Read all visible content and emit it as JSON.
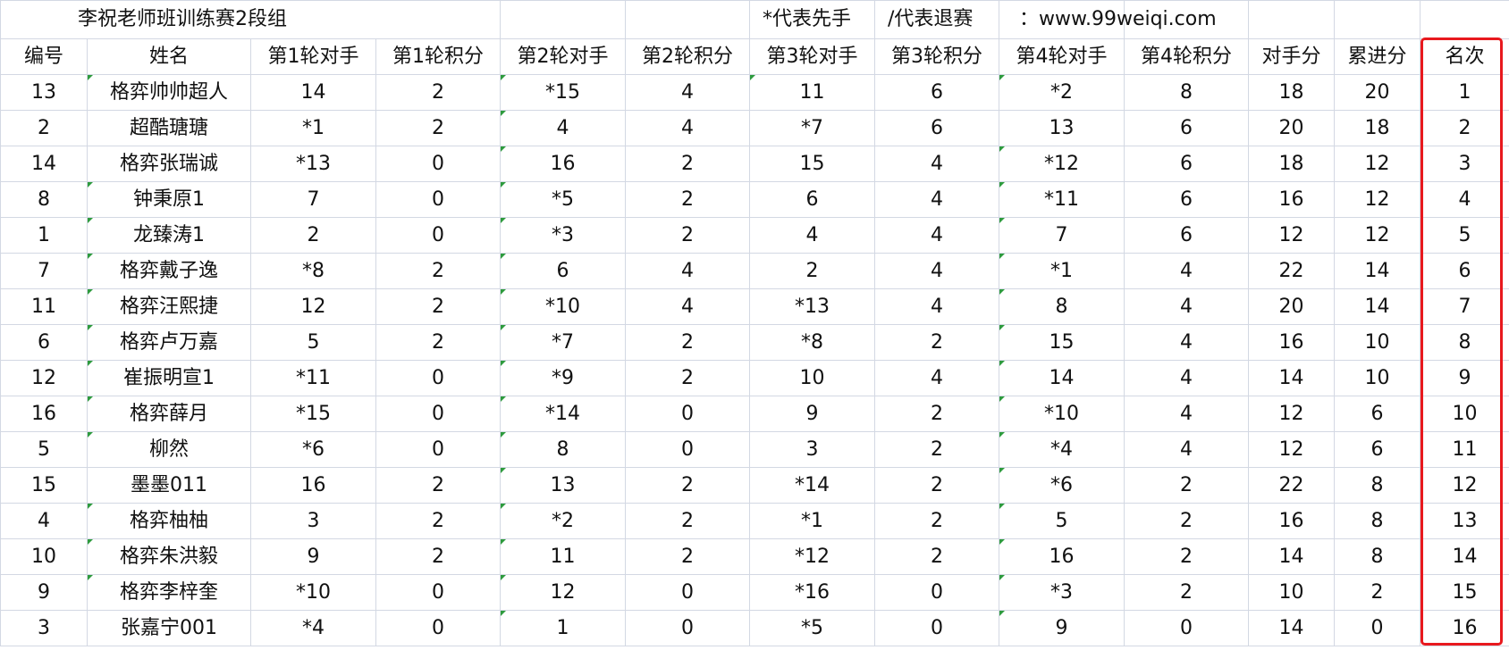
{
  "sheet": {
    "title": "李祝老师班训练赛2段组",
    "note_first_move": "*代表先手",
    "note_withdraw": "/代表退赛",
    "website": "：www.99weiqi.com",
    "headers": [
      "编号",
      "姓名",
      "第1轮对手",
      "第1轮积分",
      "第2轮对手",
      "第2轮积分",
      "第3轮对手",
      "第3轮积分",
      "第4轮对手",
      "第4轮积分",
      "对手分",
      "累进分",
      "名次"
    ],
    "rows": [
      [
        "13",
        "格弈帅帅超人",
        "14",
        "2",
        "*15",
        "4",
        "11",
        "6",
        "*2",
        "8",
        "18",
        "20",
        "1"
      ],
      [
        "2",
        "超酷瑭瑭",
        "*1",
        "2",
        "4",
        "4",
        "*7",
        "6",
        "13",
        "6",
        "20",
        "18",
        "2"
      ],
      [
        "14",
        "格弈张瑞诚",
        "*13",
        "0",
        "16",
        "2",
        "15",
        "4",
        "*12",
        "6",
        "18",
        "12",
        "3"
      ],
      [
        "8",
        "钟秉原1",
        "7",
        "0",
        "*5",
        "2",
        "6",
        "4",
        "*11",
        "6",
        "16",
        "12",
        "4"
      ],
      [
        "1",
        "龙臻涛1",
        "2",
        "0",
        "*3",
        "2",
        "4",
        "4",
        "7",
        "6",
        "12",
        "12",
        "5"
      ],
      [
        "7",
        "格弈戴子逸",
        "*8",
        "2",
        "6",
        "4",
        "2",
        "4",
        "*1",
        "4",
        "22",
        "14",
        "6"
      ],
      [
        "11",
        "格弈汪熙捷",
        "12",
        "2",
        "*10",
        "4",
        "*13",
        "4",
        "8",
        "4",
        "20",
        "14",
        "7"
      ],
      [
        "6",
        "格弈卢万嘉",
        "5",
        "2",
        "*7",
        "2",
        "*8",
        "2",
        "15",
        "4",
        "16",
        "10",
        "8"
      ],
      [
        "12",
        "崔振明宣1",
        "*11",
        "0",
        "*9",
        "2",
        "10",
        "4",
        "14",
        "4",
        "14",
        "10",
        "9"
      ],
      [
        "16",
        "格弈薛月",
        "*15",
        "0",
        "*14",
        "0",
        "9",
        "2",
        "*10",
        "4",
        "12",
        "6",
        "10"
      ],
      [
        "5",
        "柳然",
        "*6",
        "0",
        "8",
        "0",
        "3",
        "2",
        "*4",
        "4",
        "12",
        "6",
        "11"
      ],
      [
        "15",
        "墨墨011",
        "16",
        "2",
        "13",
        "2",
        "*14",
        "2",
        "*6",
        "2",
        "22",
        "8",
        "12"
      ],
      [
        "4",
        "格弈柚柚",
        "3",
        "2",
        "*2",
        "2",
        "*1",
        "2",
        "5",
        "2",
        "16",
        "8",
        "13"
      ],
      [
        "10",
        "格弈朱洪毅",
        "9",
        "2",
        "11",
        "2",
        "*12",
        "2",
        "16",
        "2",
        "14",
        "8",
        "14"
      ],
      [
        "9",
        "格弈李梓奎",
        "*10",
        "0",
        "12",
        "0",
        "*16",
        "0",
        "*3",
        "2",
        "10",
        "2",
        "15"
      ],
      [
        "3",
        "张嘉宁001",
        "*4",
        "0",
        "1",
        "0",
        "*5",
        "0",
        "9",
        "0",
        "14",
        "0",
        "16"
      ]
    ],
    "colors": {
      "grid": "#d3d8e3",
      "highlight": "#e8191e",
      "marker": "#2e9b3e"
    }
  }
}
